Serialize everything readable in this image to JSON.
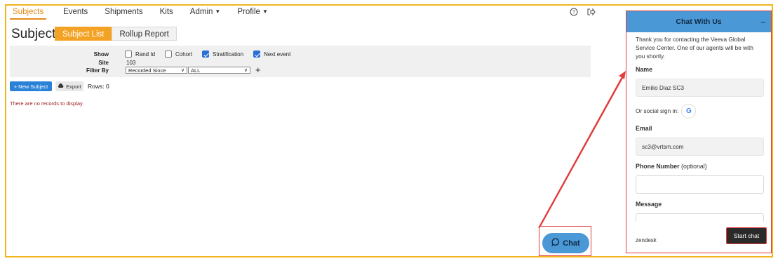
{
  "nav": {
    "items": [
      {
        "label": "Subjects",
        "active": true,
        "caret": false
      },
      {
        "label": "Events",
        "active": false,
        "caret": false
      },
      {
        "label": "Shipments",
        "active": false,
        "caret": false
      },
      {
        "label": "Kits",
        "active": false,
        "caret": false
      },
      {
        "label": "Admin",
        "active": false,
        "caret": true
      },
      {
        "label": "Profile",
        "active": false,
        "caret": true
      }
    ],
    "help_icon": "?",
    "logout_icon": "⇨"
  },
  "page": {
    "title": "Subjects",
    "tabs": [
      {
        "label": "Subject List",
        "active": true
      },
      {
        "label": "Rollup Report",
        "active": false
      }
    ]
  },
  "filters": {
    "show_label": "Show",
    "checkboxes": [
      {
        "label": "Rand Id",
        "checked": false
      },
      {
        "label": "Cohort",
        "checked": false
      },
      {
        "label": "Stratification",
        "checked": true
      },
      {
        "label": "Next event",
        "checked": true
      }
    ],
    "site_label": "Site",
    "site_value": "103",
    "filter_by_label": "Filter By",
    "filter_by_select": "Recorded Since",
    "filter_value_select": "ALL",
    "add_icon": "+"
  },
  "actions": {
    "new_subject": "+ New Subject",
    "export": "Export",
    "rows": "Rows: 0"
  },
  "empty_message": "There are no records to display.",
  "chat_launcher": {
    "label": "Chat"
  },
  "chat": {
    "title": "Chat With Us",
    "minimize": "–",
    "intro": "Thank you for contacting the Veeva Global Service Center. One of our agents will be with you shortly.",
    "name_label": "Name",
    "name_value": "Emilio Diaz SC3",
    "social_label": "Or social sign in:",
    "email_label": "Email",
    "email_value": "sc3@vrtsm.com",
    "phone_label": "Phone Number",
    "phone_optional": "(optional)",
    "phone_value": "",
    "message_label": "Message",
    "footer_brand": "zendesk",
    "start_button": "Start chat"
  },
  "colors": {
    "accent_orange": "#f4a224",
    "primary_blue": "#2a82d8",
    "chat_blue": "#4b98d6",
    "annotation_red": "#e23c3c",
    "frame_yellow": "#f2b51c"
  }
}
